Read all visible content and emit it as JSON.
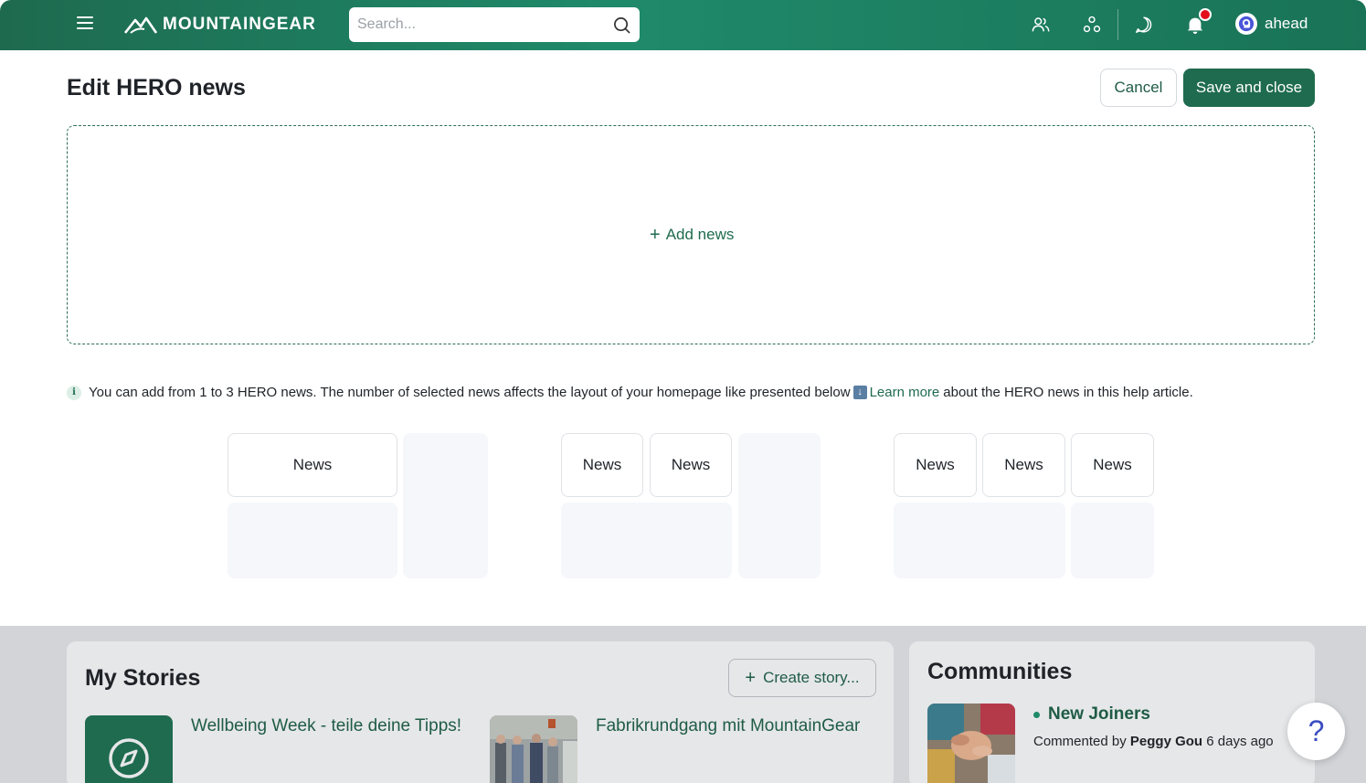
{
  "topbar": {
    "brand": "MOUNTAINGEAR",
    "search_placeholder": "Search...",
    "user_name": "ahead",
    "icons": [
      "menu-icon",
      "people-icon",
      "communities-icon",
      "chat-icon",
      "bell-icon",
      "search-icon"
    ],
    "colors": {
      "bar_start": "#1e6a4f",
      "bar_end": "#1a7356",
      "notification": "#e2101a"
    }
  },
  "page": {
    "title": "Edit HERO news",
    "cancel_label": "Cancel",
    "save_label": "Save and close",
    "add_news_label": "Add news"
  },
  "info": {
    "text_before": "You can add from 1 to 3 HERO news. The number of selected news affects the layout of your homepage like presented below",
    "link_label": "Learn more",
    "text_after": "about the HERO news in this help article."
  },
  "layouts": [
    {
      "news_count": 1,
      "news_label": "News"
    },
    {
      "news_count": 2,
      "news_label": "News"
    },
    {
      "news_count": 3,
      "news_label": "News"
    }
  ],
  "stories": {
    "title": "My Stories",
    "create_label": "Create story...",
    "items": [
      {
        "title": "Wellbeing Week - teile deine Tipps!",
        "icon": "compass-icon"
      },
      {
        "title": "Fabrikrundgang mit MountainGear",
        "icon": "photo"
      }
    ]
  },
  "communities": {
    "title": "Communities",
    "item": {
      "name": "New Joiners",
      "meta_prefix": "Commented by",
      "author": "Peggy Gou",
      "time": "6 days ago"
    }
  },
  "help": {
    "label": "?"
  },
  "accent_color": "#1f6b4f"
}
